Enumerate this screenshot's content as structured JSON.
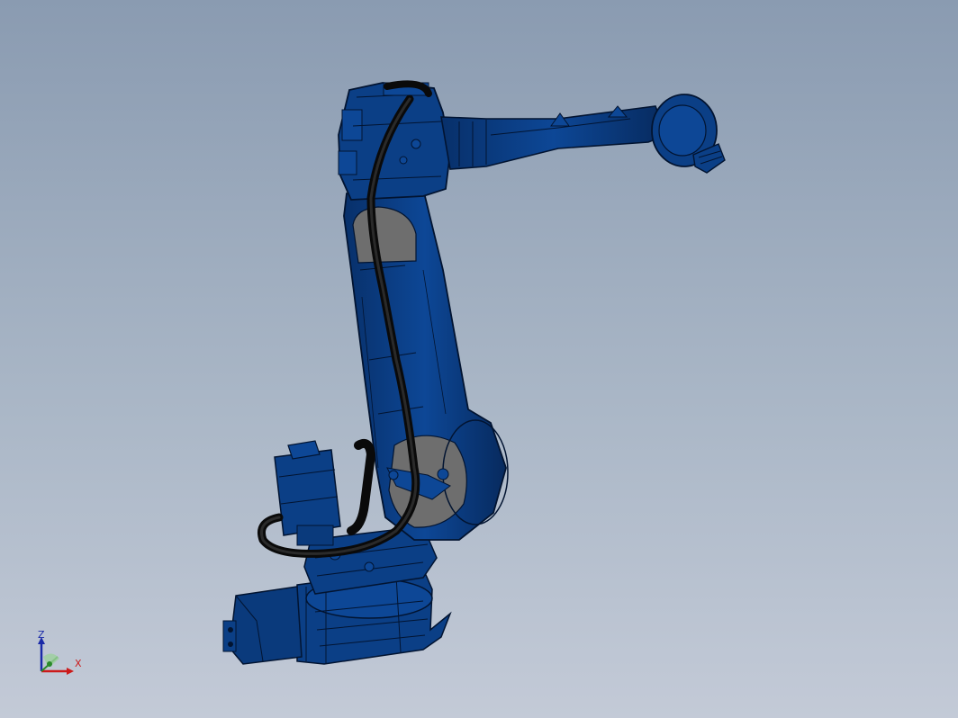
{
  "viewport": {
    "background_top": "#8a9bb1",
    "background_bottom": "#c3cad7"
  },
  "model": {
    "name": "robot-arm",
    "body_color": "#0b3f86",
    "edge_color": "#021431",
    "cable_color": "#0a0a0a",
    "panel_color": "#6e6e6e"
  },
  "triad": {
    "z_label": "Z",
    "x_label": "X",
    "z_color": "#1a2aa8",
    "x_color": "#cc1a1a"
  }
}
